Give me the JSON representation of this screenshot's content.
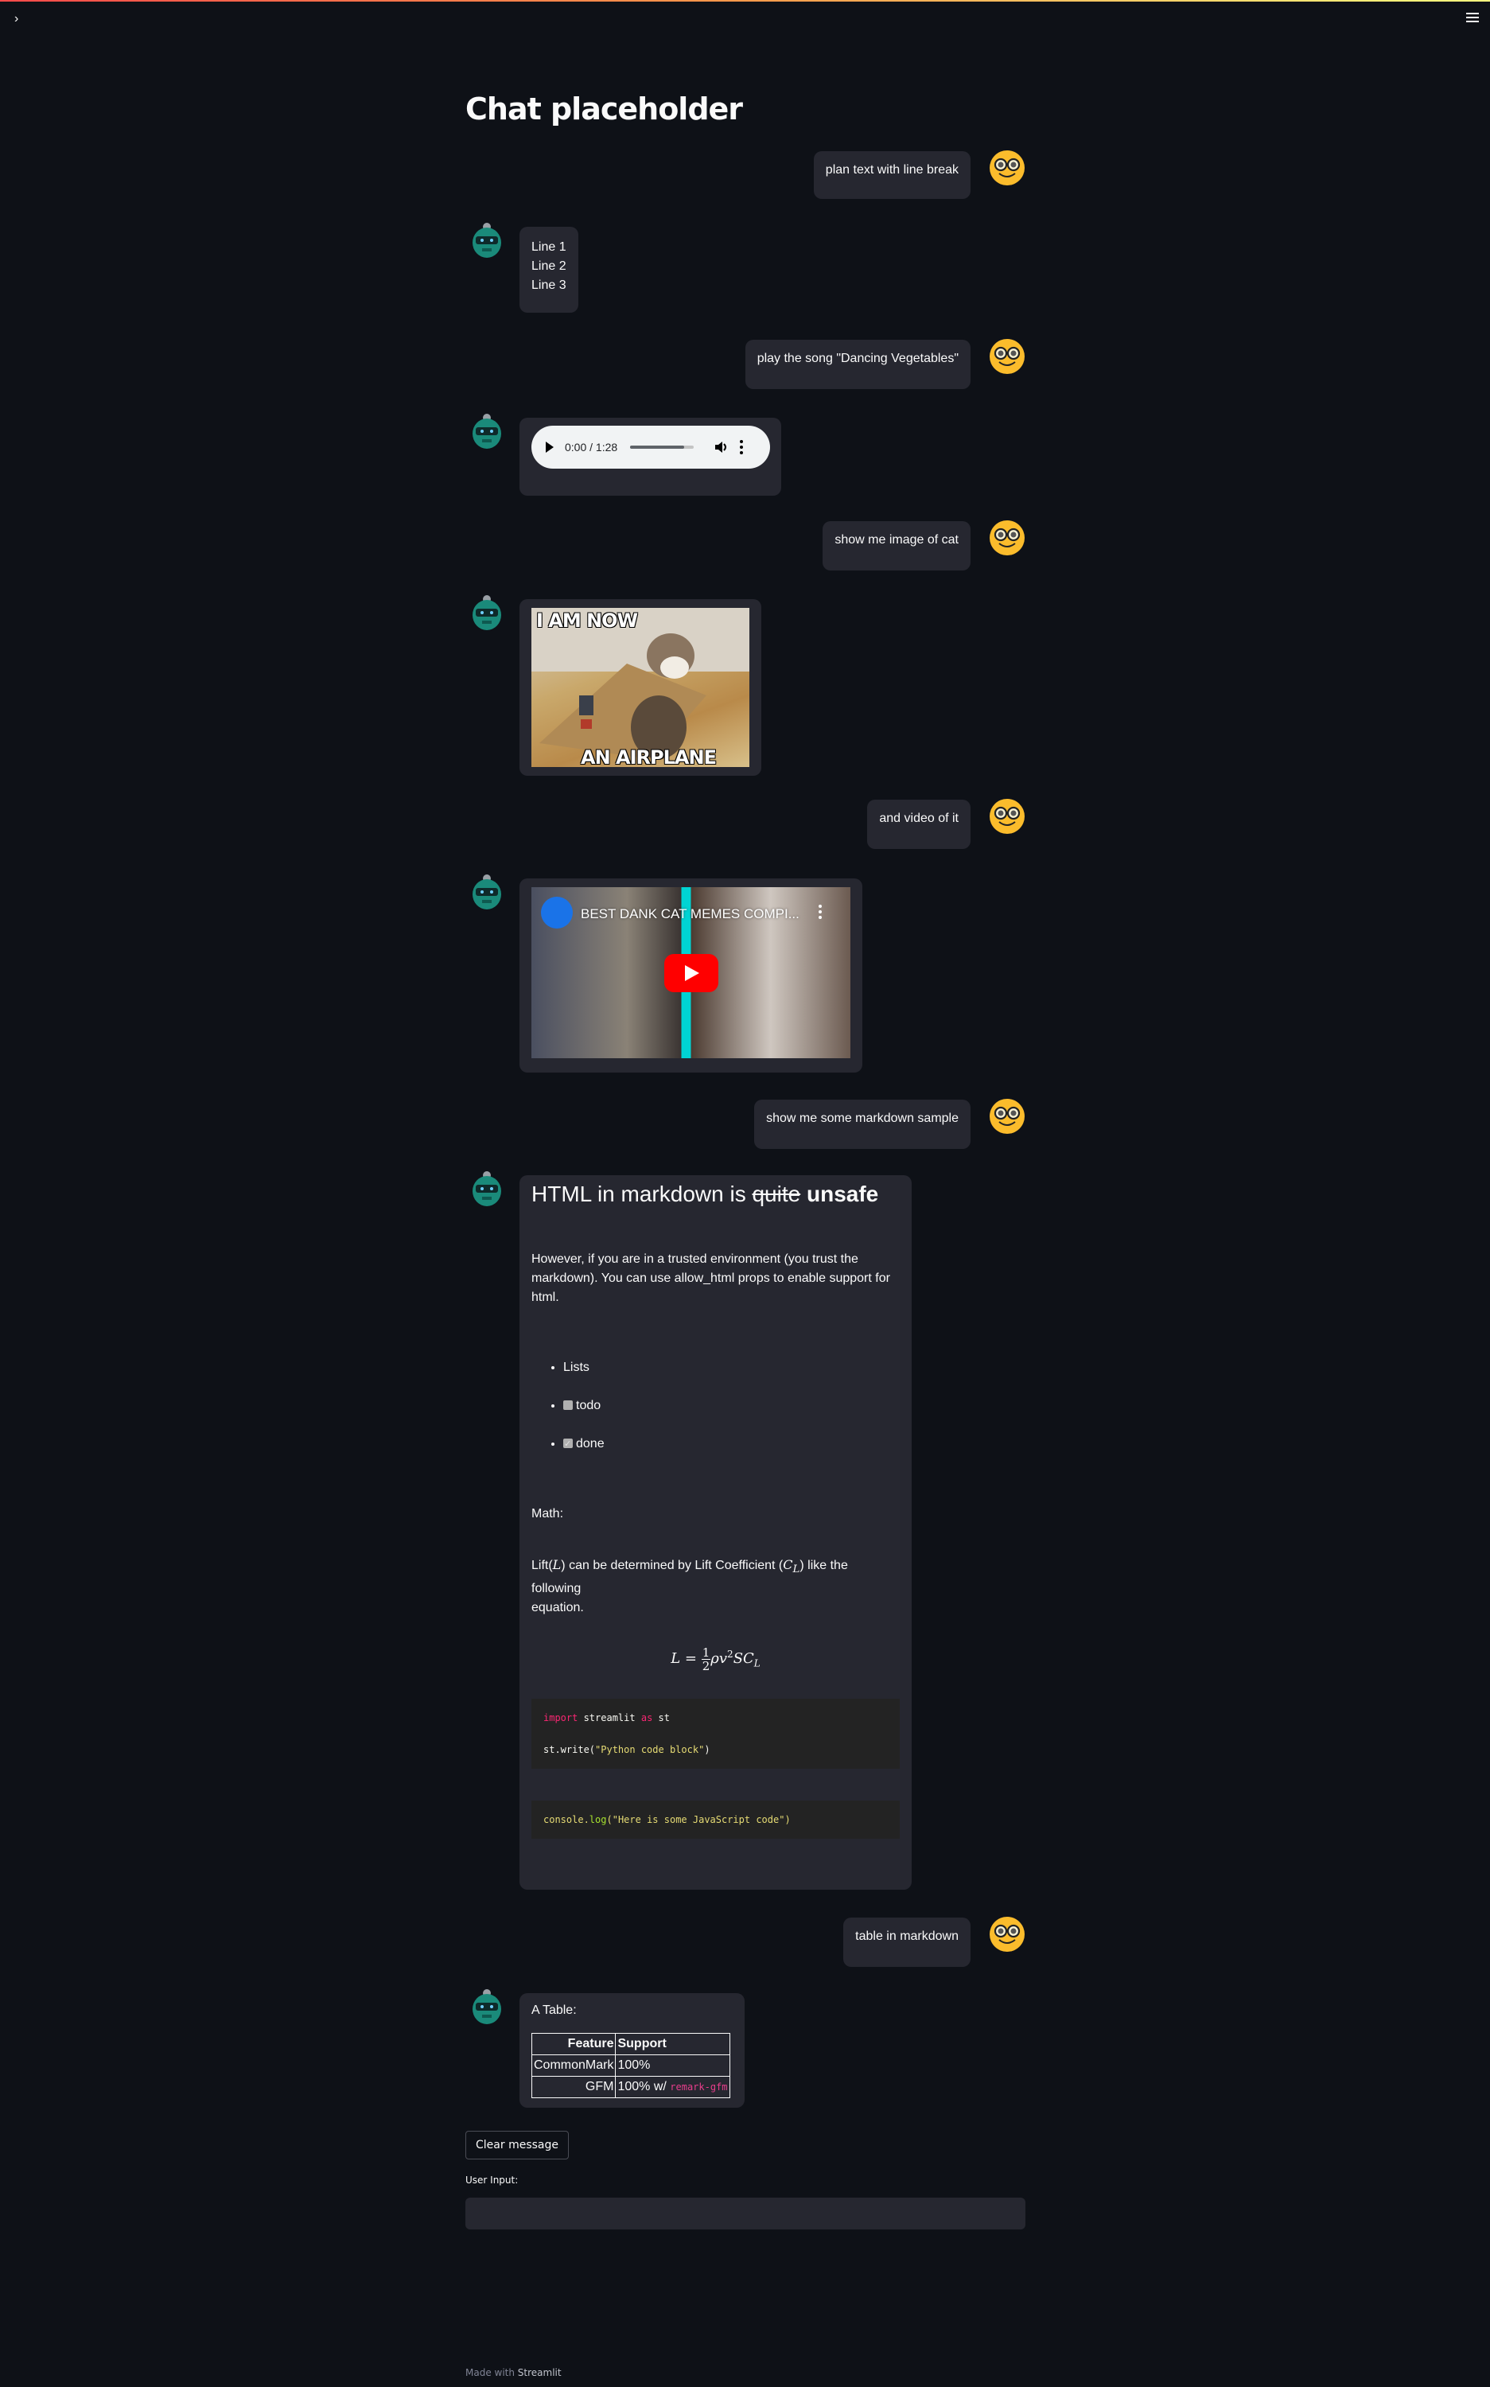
{
  "app": {
    "title": "Chat placeholder",
    "sidebar_toggle_icon": "chevron-right-icon",
    "menu_icon": "hamburger-menu-icon",
    "accent_gradient": [
      "#ff4b4b",
      "#fffd80"
    ],
    "background": "#0e1117",
    "bubble_color": "#262730"
  },
  "messages": [
    {
      "role": "user",
      "type": "text",
      "text": "plan text with line break",
      "avatar": "nerd-face-icon"
    },
    {
      "role": "assistant",
      "type": "text",
      "lines": [
        "Line 1",
        "Line 2",
        "Line 3"
      ],
      "avatar": "robot-icon"
    },
    {
      "role": "user",
      "type": "text",
      "text": "play the song \"Dancing Vegetables\"",
      "avatar": "nerd-face-icon"
    },
    {
      "role": "assistant",
      "type": "audio",
      "audio": {
        "time_display": "0:00 / 1:28",
        "current": "0:00",
        "duration": "1:28",
        "buffered_fraction": 0.85
      },
      "avatar": "robot-icon"
    },
    {
      "role": "user",
      "type": "text",
      "text": "show me image of cat",
      "avatar": "nerd-face-icon"
    },
    {
      "role": "assistant",
      "type": "image",
      "image": {
        "caption_top": "I AM NOW",
        "caption_bottom": "AN AIRPLANE"
      },
      "avatar": "robot-icon"
    },
    {
      "role": "user",
      "type": "text",
      "text": "and video of it",
      "avatar": "nerd-face-icon"
    },
    {
      "role": "assistant",
      "type": "video",
      "video": {
        "title": "BEST DANK CAT MEMES COMPI..."
      },
      "avatar": "robot-icon"
    },
    {
      "role": "user",
      "type": "text",
      "text": "show me some markdown sample",
      "avatar": "nerd-face-icon"
    },
    {
      "role": "assistant",
      "type": "markdown",
      "avatar": "robot-icon",
      "markdown": {
        "heading_plain": "HTML in markdown is ",
        "heading_struck": "quite",
        "heading_bold": "unsafe",
        "paragraph": "However, if you are in a trusted environment (you trust the markdown). You can use allow_html props to enable support for html.",
        "list": [
          {
            "text": "Lists",
            "checkbox": null
          },
          {
            "text": "todo",
            "checkbox": false
          },
          {
            "text": "done",
            "checkbox": true
          }
        ],
        "math_label": "Math:",
        "math_sentence_1": "Lift(",
        "math_L": "L",
        "math_sentence_2": ") can be determined by Lift Coefficient (",
        "math_CL": "C",
        "math_CL_sub": "L",
        "math_sentence_3": ") like the",
        "math_sentence_4": "following",
        "math_sentence_5": "equation.",
        "equation": {
          "lhs": "L =",
          "num": "1",
          "den": "2",
          "rhs_rho": "ρv",
          "rhs_sup": "2",
          "rhs_rest": "SC",
          "rhs_sub": "L"
        },
        "python_code": {
          "kw_import": "import",
          "mod": " streamlit ",
          "kw_as": "as",
          "alias": " st",
          "line2_pre": "st.write(",
          "line2_str": "\"Python code block\"",
          "line2_post": ")"
        },
        "js_code": {
          "obj": "console.",
          "fn": "log",
          "open": "(",
          "str": "\"Here is some JavaScript code\"",
          "close": ")"
        }
      }
    },
    {
      "role": "user",
      "type": "text",
      "text": "table in markdown",
      "avatar": "nerd-face-icon"
    },
    {
      "role": "assistant",
      "type": "table",
      "avatar": "robot-icon",
      "table": {
        "intro": "A Table:",
        "headers": [
          "Feature",
          "Support"
        ],
        "rows": [
          [
            "CommonMark",
            "100%"
          ],
          [
            "GFM",
            "100% w/ ",
            "remark-gfm"
          ]
        ]
      }
    }
  ],
  "controls": {
    "clear_button": "Clear message",
    "input_label": "User Input:",
    "input_value": "",
    "input_placeholder": ""
  },
  "footer": {
    "prefix": "Made with ",
    "brand": "Streamlit"
  }
}
